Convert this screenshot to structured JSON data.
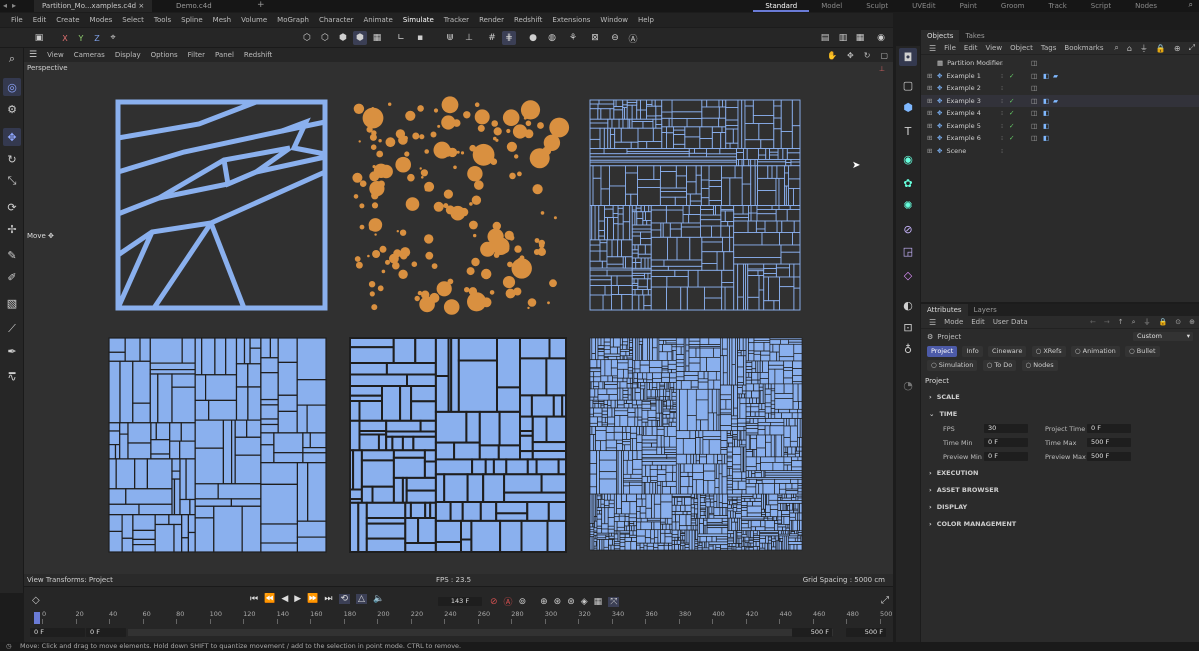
{
  "file_tabs": [
    {
      "label": "Partition_Mo...xamples.c4d",
      "active": true
    },
    {
      "label": "Demo.c4d",
      "active": false
    }
  ],
  "layout_tabs": [
    "Standard",
    "Model",
    "Sculpt",
    "UVEdit",
    "Paint",
    "Groom",
    "Track",
    "Script",
    "Nodes"
  ],
  "selected_layout": "Standard",
  "menu": [
    "File",
    "Edit",
    "Create",
    "Modes",
    "Select",
    "Tools",
    "Spline",
    "Mesh",
    "Volume",
    "MoGraph",
    "Character",
    "Animate",
    "Simulate",
    "Tracker",
    "Render",
    "Redshift",
    "Extensions",
    "Window",
    "Help"
  ],
  "axis_buttons": [
    "X",
    "Y",
    "Z"
  ],
  "view_menu": [
    "View",
    "Cameras",
    "Display",
    "Options",
    "Filter",
    "Panel",
    "Redshift"
  ],
  "viewport": {
    "label": "Perspective",
    "tool_label": "Move",
    "view_transform": "View Transforms: Project",
    "fps": "FPS : 23.5",
    "grid_spacing": "Grid Spacing : 5000 cm"
  },
  "timeline": {
    "current_frame": "143 F",
    "ruler_ticks": [
      "0",
      "20",
      "40",
      "60",
      "80",
      "100",
      "120",
      "140",
      "160",
      "180",
      "200",
      "220",
      "240",
      "260",
      "280",
      "300",
      "320",
      "340",
      "360",
      "380",
      "400",
      "420",
      "440",
      "460",
      "480",
      "500"
    ],
    "start_a": "0 F",
    "start_b": "0 F",
    "end_a": "500 F",
    "end_b": "500 F"
  },
  "objects_panel": {
    "tabs": [
      "Objects",
      "Takes"
    ],
    "menu": [
      "File",
      "Edit",
      "View",
      "Object",
      "Tags",
      "Bookmarks"
    ],
    "rows": [
      {
        "name": "Partition Modifier"
      },
      {
        "name": "Example 1"
      },
      {
        "name": "Example 2"
      },
      {
        "name": "Example 3"
      },
      {
        "name": "Example 4"
      },
      {
        "name": "Example 5"
      },
      {
        "name": "Example 6"
      },
      {
        "name": "Scene"
      }
    ]
  },
  "attributes_panel": {
    "tabs": [
      "Attributes",
      "Layers"
    ],
    "menu": [
      "Mode",
      "Edit",
      "User Data"
    ],
    "object_label": "Project",
    "dropdown_value": "Custom",
    "buttons_row1": [
      "Project",
      "Info",
      "Cineware",
      "XRefs",
      "Animation",
      "Bullet"
    ],
    "buttons_row2": [
      "Simulation",
      "To Do",
      "Nodes"
    ],
    "section_title": "Project",
    "sections": {
      "scale": "SCALE",
      "time": "TIME",
      "execution": "EXECUTION",
      "asset_browser": "ASSET BROWSER",
      "display": "DISPLAY",
      "color_management": "COLOR MANAGEMENT"
    },
    "time_fields": {
      "fps_label": "FPS",
      "fps_value": "30",
      "project_time_label": "Project Time",
      "project_time_value": "0 F",
      "time_min_label": "Time Min",
      "time_min_value": "0 F",
      "time_max_label": "Time Max",
      "time_max_value": "500 F",
      "preview_min_label": "Preview Min",
      "preview_min_value": "0 F",
      "preview_max_label": "Preview Max",
      "preview_max_value": "500 F"
    }
  },
  "status_text": "Move: Click and drag to move elements. Hold down SHIFT to quantize movement / add to the selection in point mode. CTRL to remove.",
  "colors": {
    "accent": "#6a7bd6",
    "partition_blue": "#8ab0ee",
    "sphere_orange": "#d99040",
    "viewport_bg": "#303030"
  }
}
